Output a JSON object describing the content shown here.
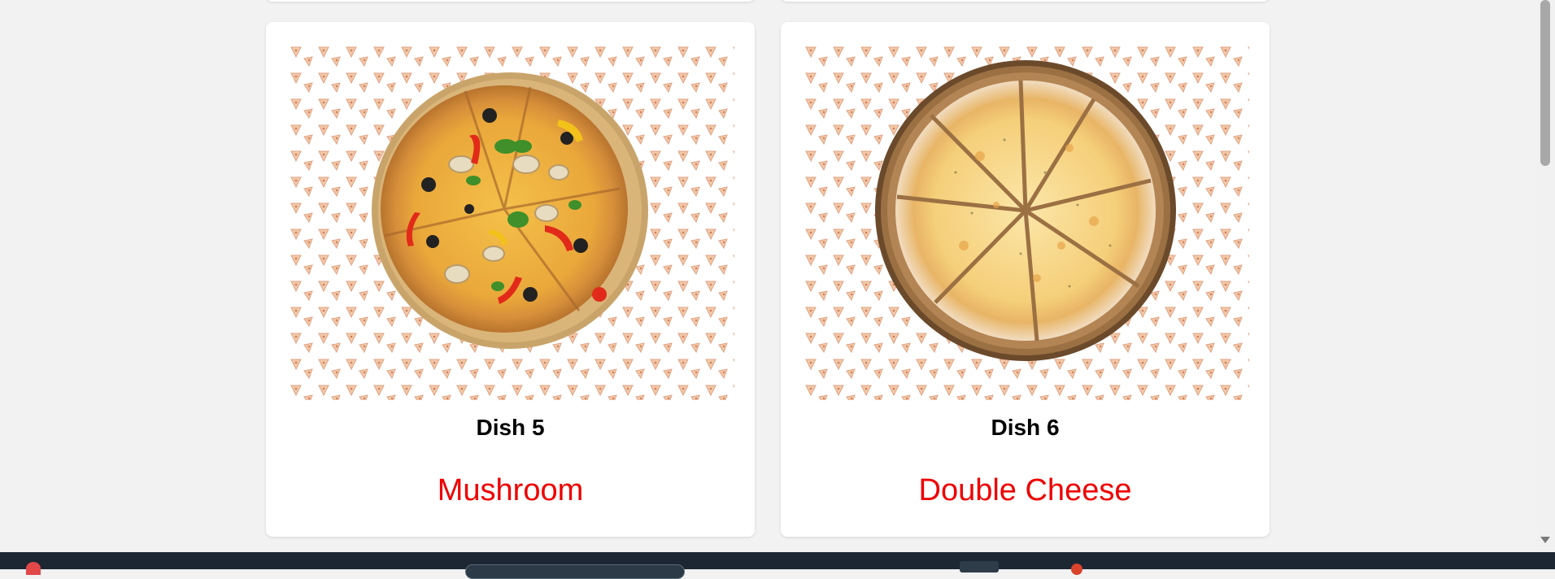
{
  "cards": [
    {
      "title": "Dish 5",
      "name": "Mushroom",
      "image_alt": "Mushroom pizza with olives, peppers and basil on a wooden board"
    },
    {
      "title": "Dish 6",
      "name": "Double Cheese",
      "image_alt": "Double cheese pizza sliced on a wooden board"
    }
  ],
  "taskbar": {
    "left_text": "",
    "clock": ""
  },
  "colors": {
    "accent": "#ee0000",
    "page_background": "#f2f2f2",
    "card_background": "#ffffff"
  },
  "icons": [
    "notification-badge-icon",
    "search-box",
    "taskbar-app-icon",
    "taskbar-app-dot-icon"
  ]
}
